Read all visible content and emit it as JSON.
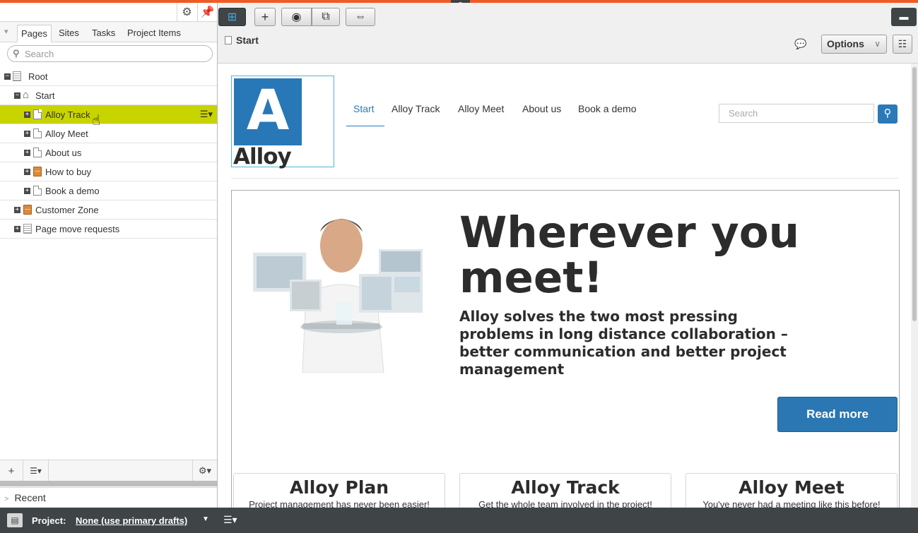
{
  "left_panel": {
    "tabs": [
      "Pages",
      "Sites",
      "Tasks",
      "Project Items"
    ],
    "search_placeholder": "Search",
    "tree": [
      {
        "label": "Root",
        "icon": "list-page-icon"
      },
      {
        "label": "Start",
        "icon": "home-icon"
      },
      {
        "label": "Alloy Track",
        "icon": "page-icon"
      },
      {
        "label": "Alloy Meet",
        "icon": "page-icon"
      },
      {
        "label": "About us",
        "icon": "page-icon"
      },
      {
        "label": "How to buy",
        "icon": "folder-icon"
      },
      {
        "label": "Book a demo",
        "icon": "page-icon"
      },
      {
        "label": "Customer Zone",
        "icon": "folder-icon"
      },
      {
        "label": "Page move requests",
        "icon": "list-page-icon"
      }
    ],
    "recent_label": "Recent"
  },
  "toolbar": {
    "page_title": "Start",
    "options_label": "Options"
  },
  "site": {
    "logo_letter": "A",
    "logo_word": "Alloy",
    "nav": [
      "Start",
      "Alloy Track",
      "Alloy Meet",
      "About us",
      "Book a demo"
    ],
    "search_placeholder": "Search",
    "hero_title": "Wherever you meet!",
    "hero_subtitle": "Alloy solves the two most pressing problems in long distance collaboration – better communication and better project management",
    "read_more": "Read more",
    "cards": [
      {
        "title": "Alloy Plan",
        "text": "Project management has never been easier!"
      },
      {
        "title": "Alloy Track",
        "text": "Get the whole team involved in the project!"
      },
      {
        "title": "Alloy Meet",
        "text": "You've never had a meeting like this before!"
      }
    ]
  },
  "bottom_bar": {
    "project_label": "Project:",
    "project_value": "None (use primary drafts)"
  },
  "colors": {
    "accent": "#ef5b25",
    "selected_row": "#c8d400",
    "brand_blue": "#2a77b3"
  }
}
